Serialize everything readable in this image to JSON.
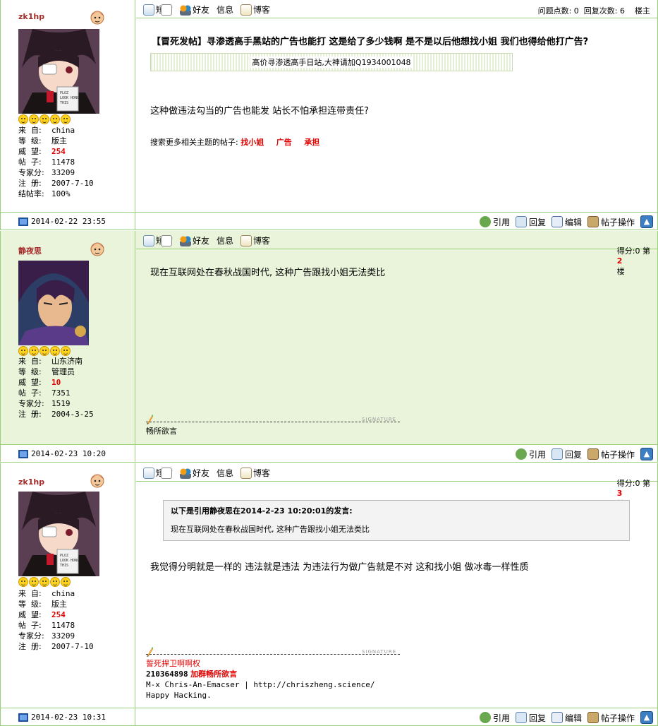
{
  "toolbar_links": [
    "短信",
    "好友",
    "信息",
    "博客"
  ],
  "posts": [
    {
      "username": "zk1hp",
      "avatar": "anime-girl-eyepatch",
      "info": [
        {
          "k": "来  自:",
          "v": "china"
        },
        {
          "k": "等  级:",
          "v": "版主"
        },
        {
          "k": "威  望:",
          "v": "254"
        },
        {
          "k": "帖  子:",
          "v": "11478"
        },
        {
          "k": "专家分:",
          "v": "33209"
        },
        {
          "k": "注  册:",
          "v": "2007-7-10"
        },
        {
          "k": "结帖率:",
          "v": "100%"
        }
      ],
      "header_right": "问题点数: 0  回复次数: 6    楼主",
      "title": "【冒死发帖】寻渗透高手黑站的广告也能打 这是给了多少钱啊 是不是以后他想找小姐 我们也得给他打广告?",
      "ad_text": "高价寻渗透高手日站,大神请加Q1934001048",
      "body": "这种做违法勾当的广告也能发 站长不怕承担连带责任?",
      "tags_label": "搜索更多相关主题的帖子:",
      "tags": [
        "找小姐",
        "广告",
        "承担"
      ],
      "date": "2014-02-22 23:55",
      "actions": [
        "引用",
        "回复",
        "编辑",
        "帖子操作"
      ]
    },
    {
      "username": "静夜思",
      "avatar": "anime-swordsman",
      "info": [
        {
          "k": "来  自:",
          "v": "山东济南"
        },
        {
          "k": "等  级:",
          "v": "管理员"
        },
        {
          "k": "威  望:",
          "v": "10"
        },
        {
          "k": "帖  子:",
          "v": "7351"
        },
        {
          "k": "专家分:",
          "v": "1519"
        },
        {
          "k": "注  册:",
          "v": "2004-3-25"
        }
      ],
      "score_label": "得分:0 第",
      "floor": "2",
      "floor_suffix": "楼",
      "body": "现在互联网处在春秋战国时代, 这种广告跟找小姐无法类比",
      "signature_label": "SIGNATURE",
      "signature": "畅所欲言",
      "date": "2014-02-23 10:20",
      "actions": [
        "引用",
        "回复"
      ]
    },
    {
      "username": "zk1hp",
      "avatar": "anime-girl-eyepatch",
      "info": [
        {
          "k": "来  自:",
          "v": "china"
        },
        {
          "k": "等  级:",
          "v": "版主"
        },
        {
          "k": "威  望:",
          "v": "254"
        },
        {
          "k": "帖  子:",
          "v": "11478"
        },
        {
          "k": "专家分:",
          "v": "33209"
        },
        {
          "k": "注  册:",
          "v": "2007-7-10"
        }
      ],
      "score_label": "得分:0 第",
      "floor": "3",
      "floor_suffix": "楼",
      "quote_prefix": "以下是引用",
      "quote_author": "静夜思",
      "quote_mid": "在2014-2-23 10:20:01的发言:",
      "quote_body": "现在互联网处在春秋战国时代, 这种广告跟找小姐无法类比",
      "body": "我觉得分明就是一样的 违法就是违法 为违法行为做广告就是不对 这和找小姐 做冰毒一样性质",
      "signature_label": "SIGNATURE",
      "sig_line1": "誓死捍卫啊啊权",
      "sig_qq": "210364898",
      "sig_group": "加群畅所欲言",
      "sig_line3": "M-x Chris-An-Emacser | http://chriszheng.science/",
      "sig_line4": "Happy Hacking.",
      "date": "2014-02-23 10:31",
      "actions": [
        "引用",
        "回复",
        "编辑",
        "帖子操作"
      ]
    }
  ]
}
